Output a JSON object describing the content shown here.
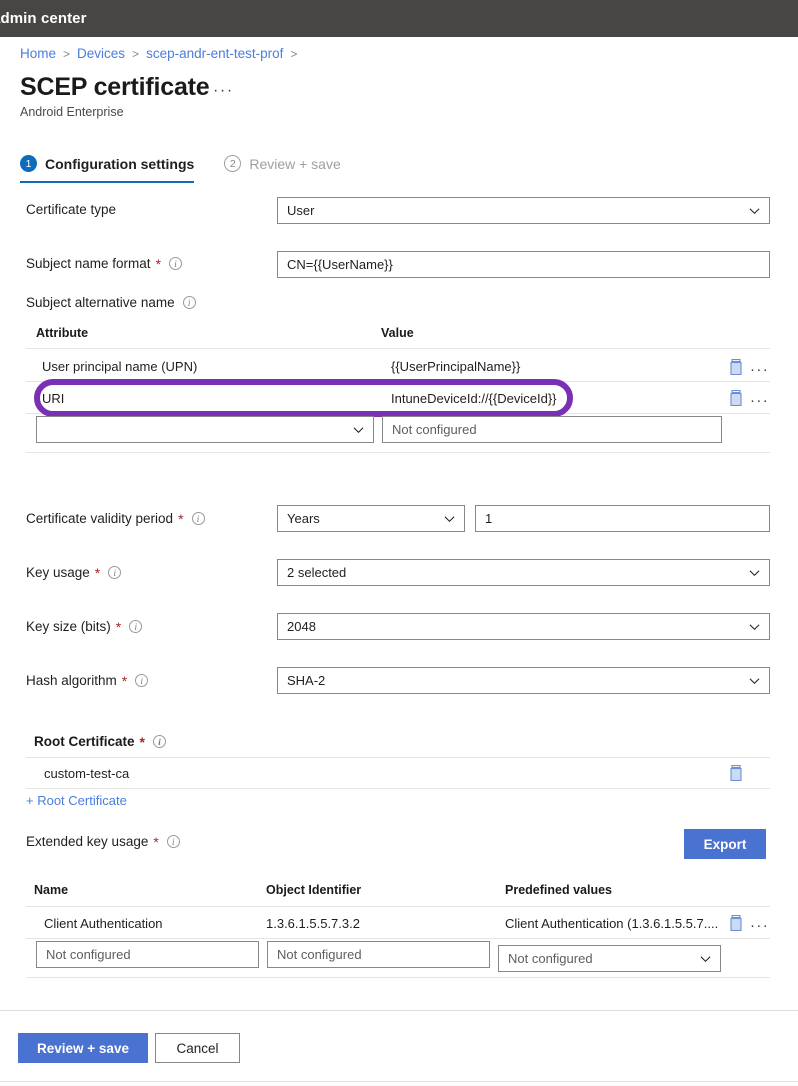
{
  "topbar": {
    "title": "admin center"
  },
  "breadcrumb": {
    "items": [
      {
        "label": "Home"
      },
      {
        "label": "Devices"
      },
      {
        "label": "scep-andr-ent-test-prof"
      }
    ],
    "separator": ">"
  },
  "header": {
    "title": "SCEP certificate",
    "overflow": "···",
    "subtitle": "Android Enterprise"
  },
  "wizard": {
    "tabs": [
      {
        "number": "1",
        "label": "Configuration settings",
        "state": "active"
      },
      {
        "number": "2",
        "label": "Review + save",
        "state": "inactive"
      }
    ]
  },
  "fields": {
    "certificate_type": {
      "label": "Certificate type",
      "value": "User"
    },
    "subject_name_format": {
      "label": "Subject name format",
      "required": "*",
      "value": "CN={{UserName}}"
    },
    "subject_alternative_name": {
      "label": "Subject alternative name"
    },
    "certificate_validity_period": {
      "label": "Certificate validity period",
      "required": "*",
      "unit": "Years",
      "amount": "1"
    },
    "key_usage": {
      "label": "Key usage",
      "required": "*",
      "value": "2 selected"
    },
    "key_size": {
      "label": "Key size (bits)",
      "required": "*",
      "value": "2048"
    },
    "hash_algorithm": {
      "label": "Hash algorithm",
      "required": "*",
      "value": "SHA-2"
    },
    "root_certificate": {
      "label": "Root Certificate",
      "required": "*"
    },
    "extended_key_usage": {
      "label": "Extended key usage",
      "required": "*"
    }
  },
  "san_table": {
    "headers": {
      "attribute": "Attribute",
      "value": "Value"
    },
    "rows": [
      {
        "attribute": "User principal name (UPN)",
        "value": "{{UserPrincipalName}}",
        "highlighted": false
      },
      {
        "attribute": "URI",
        "value": "IntuneDeviceId://{{DeviceId}}",
        "highlighted": true
      }
    ],
    "new_row": {
      "attribute_value": "",
      "value_placeholder": "Not configured"
    }
  },
  "root_certificate_table": {
    "rows": [
      {
        "name": "custom-test-ca"
      }
    ],
    "add_link": "+ Root Certificate"
  },
  "eku": {
    "export_button": "Export",
    "headers": {
      "name": "Name",
      "oid": "Object Identifier",
      "predefined": "Predefined values"
    },
    "rows": [
      {
        "name": "Client Authentication",
        "oid": "1.3.6.1.5.5.7.3.2",
        "predefined": "Client Authentication (1.3.6.1.5.5.7...."
      }
    ],
    "new_row": {
      "name_placeholder": "Not configured",
      "oid_placeholder": "Not configured",
      "predefined_placeholder": "Not configured"
    }
  },
  "footer": {
    "primary_button": "Review + save",
    "secondary_button": "Cancel"
  },
  "icons": {
    "delete": "trash-icon",
    "more": "···",
    "info": "i",
    "chevron": "chevron-down-icon"
  },
  "colors": {
    "accent": "#0f6cbd",
    "link": "#4a7ddc",
    "primary_button": "#4a72d0",
    "annotation": "#7B2FB5",
    "topbar": "#484644",
    "required": "#a4262c"
  }
}
